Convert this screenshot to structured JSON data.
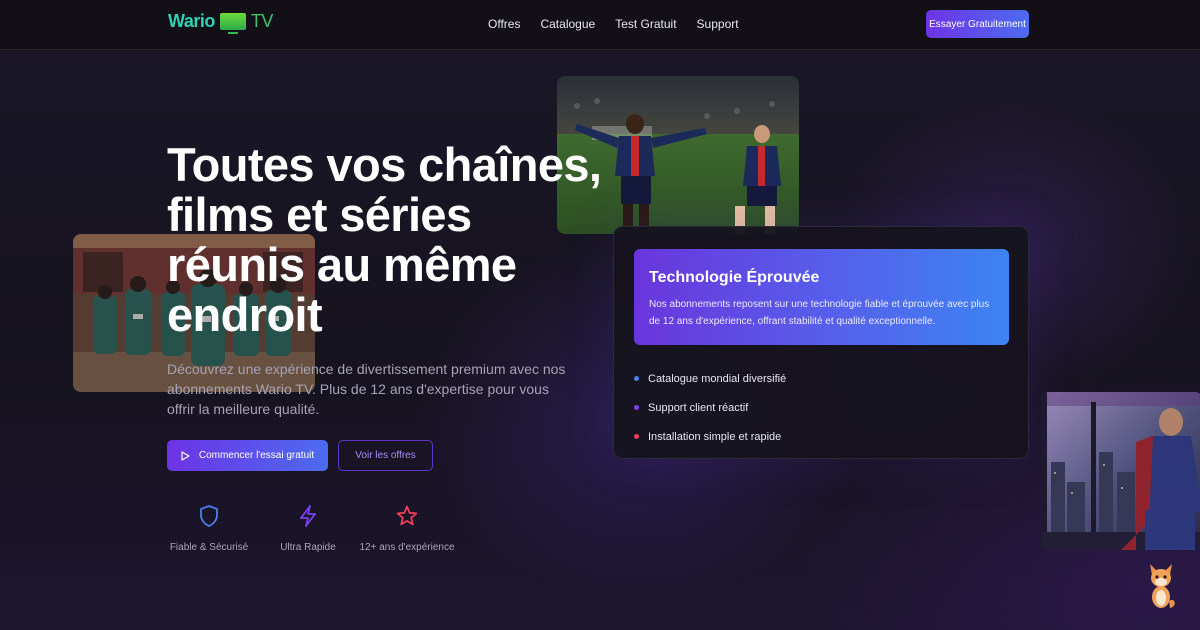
{
  "header": {
    "logo": {
      "part1": "Wario",
      "part2": "TV",
      "accent": "#2fd3b4"
    },
    "nav": [
      "Offres",
      "Catalogue",
      "Test Gratuit",
      "Support"
    ],
    "cta_label": "Essayer Gratuitement"
  },
  "hero": {
    "title": "Toutes vos chaînes,\nfilms et séries\nréunis au même\nendroit",
    "description": "Découvrez une expérience de divertissement premium avec nos abonnements Wario TV. Plus de 12 ans d'expertise pour vous offrir la meilleure qualité.",
    "primary_button": "Commencer l'essai gratuit",
    "secondary_button": "Voir les offres",
    "features": [
      {
        "icon": "shield-icon",
        "label": "Fiable & Sécurisé",
        "color": "#4a7df0"
      },
      {
        "icon": "lightning-icon",
        "label": "Ultra Rapide",
        "color": "#7b3ff0"
      },
      {
        "icon": "star-icon",
        "label": "12+ ans d'expérience",
        "color": "#ef3e55"
      }
    ]
  },
  "card": {
    "title": "Technologie Éprouvée",
    "description": "Nos abonnements reposent sur une technologie fiable et éprouvée avec plus de 12 ans d'expérience, offrant stabilité et qualité exceptionnelle.",
    "items": [
      {
        "label": "Catalogue mondial diversifié",
        "color": "#4a7df0"
      },
      {
        "label": "Support client réactif",
        "color": "#7b3ff0"
      },
      {
        "label": "Installation simple et rapide",
        "color": "#ef3e55"
      }
    ]
  },
  "images": [
    "football-photo",
    "squid-game-photo",
    "superman-photo"
  ],
  "colors": {
    "primary_gradient": [
      "#6d33e6",
      "#4d6bf0"
    ],
    "background": "#15121e"
  }
}
